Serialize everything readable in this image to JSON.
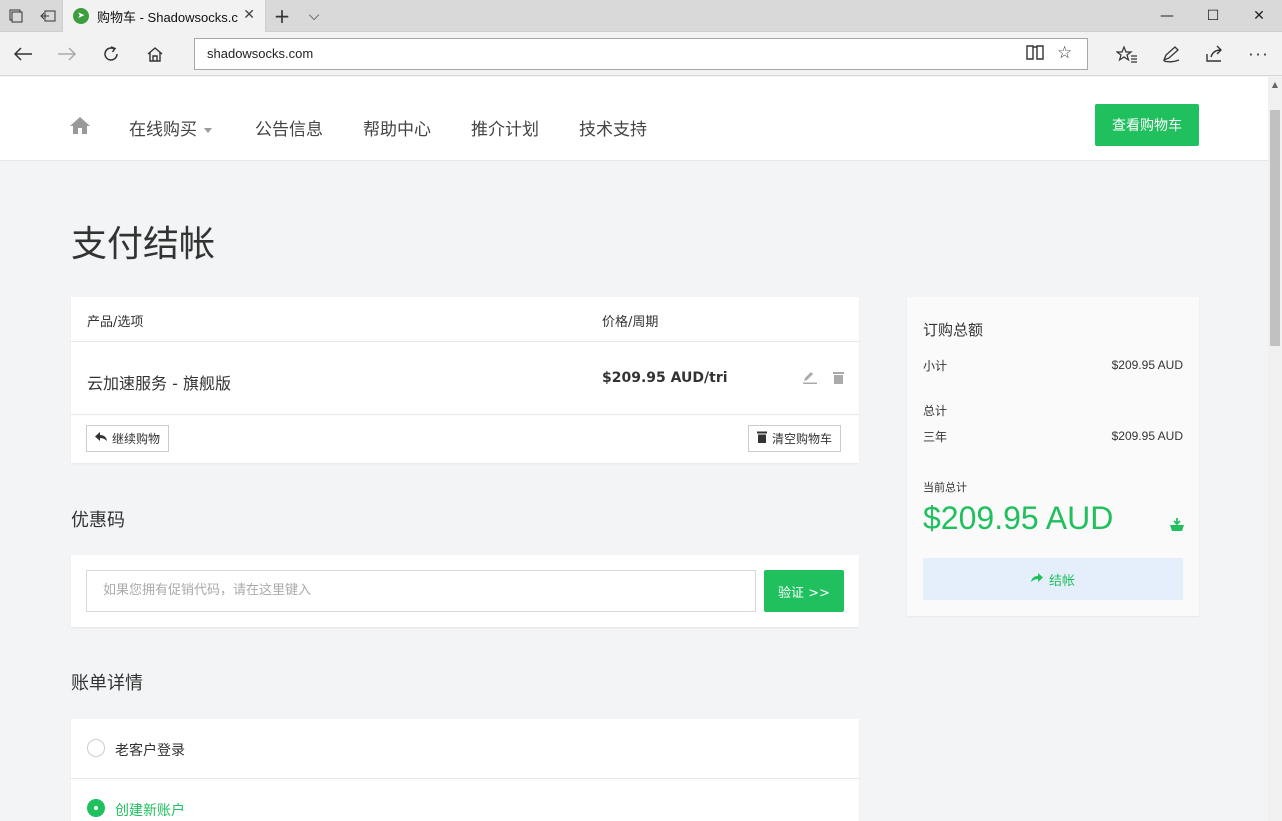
{
  "browser": {
    "tab_title": "购物车 - Shadowsocks.c",
    "url": "shadowsocks.com",
    "tab_close": "✕",
    "new_tab": "+",
    "tab_list": "⌵",
    "win_minimize": "—",
    "win_maximize": "☐",
    "win_close": "✕"
  },
  "header": {
    "menu": [
      {
        "label": "在线购买",
        "has_caret": true
      },
      {
        "label": "公告信息"
      },
      {
        "label": "帮助中心"
      },
      {
        "label": "推介计划"
      },
      {
        "label": "技术支持"
      }
    ],
    "cart_button": "查看购物车"
  },
  "page_title": "支付结帐",
  "cart": {
    "col_product": "产品/选项",
    "col_price": "价格/周期",
    "items": [
      {
        "name": "云加速服务 - 旗舰版",
        "price": "$209.95 AUD/tri"
      }
    ],
    "continue_button": "继续购物",
    "empty_button": "清空购物车"
  },
  "promo": {
    "title": "优惠码",
    "placeholder": "如果您拥有促销代码，请在这里键入",
    "verify_button": "验证 >>"
  },
  "billing": {
    "title": "账单详情",
    "options": [
      {
        "label": "老客户登录",
        "checked": false
      },
      {
        "label": "创建新账户",
        "checked": true
      }
    ]
  },
  "summary": {
    "title": "订购总额",
    "subtotal_label": "小计",
    "subtotal_value": "$209.95 AUD",
    "total_label": "总计",
    "period_label": "三年",
    "period_value": "$209.95 AUD",
    "current_total_label": "当前总计",
    "current_total_value": "$209.95 AUD",
    "checkout_button": "结帐"
  },
  "colors": {
    "accent": "#21c05f",
    "checkout_bg": "#e4effb"
  }
}
